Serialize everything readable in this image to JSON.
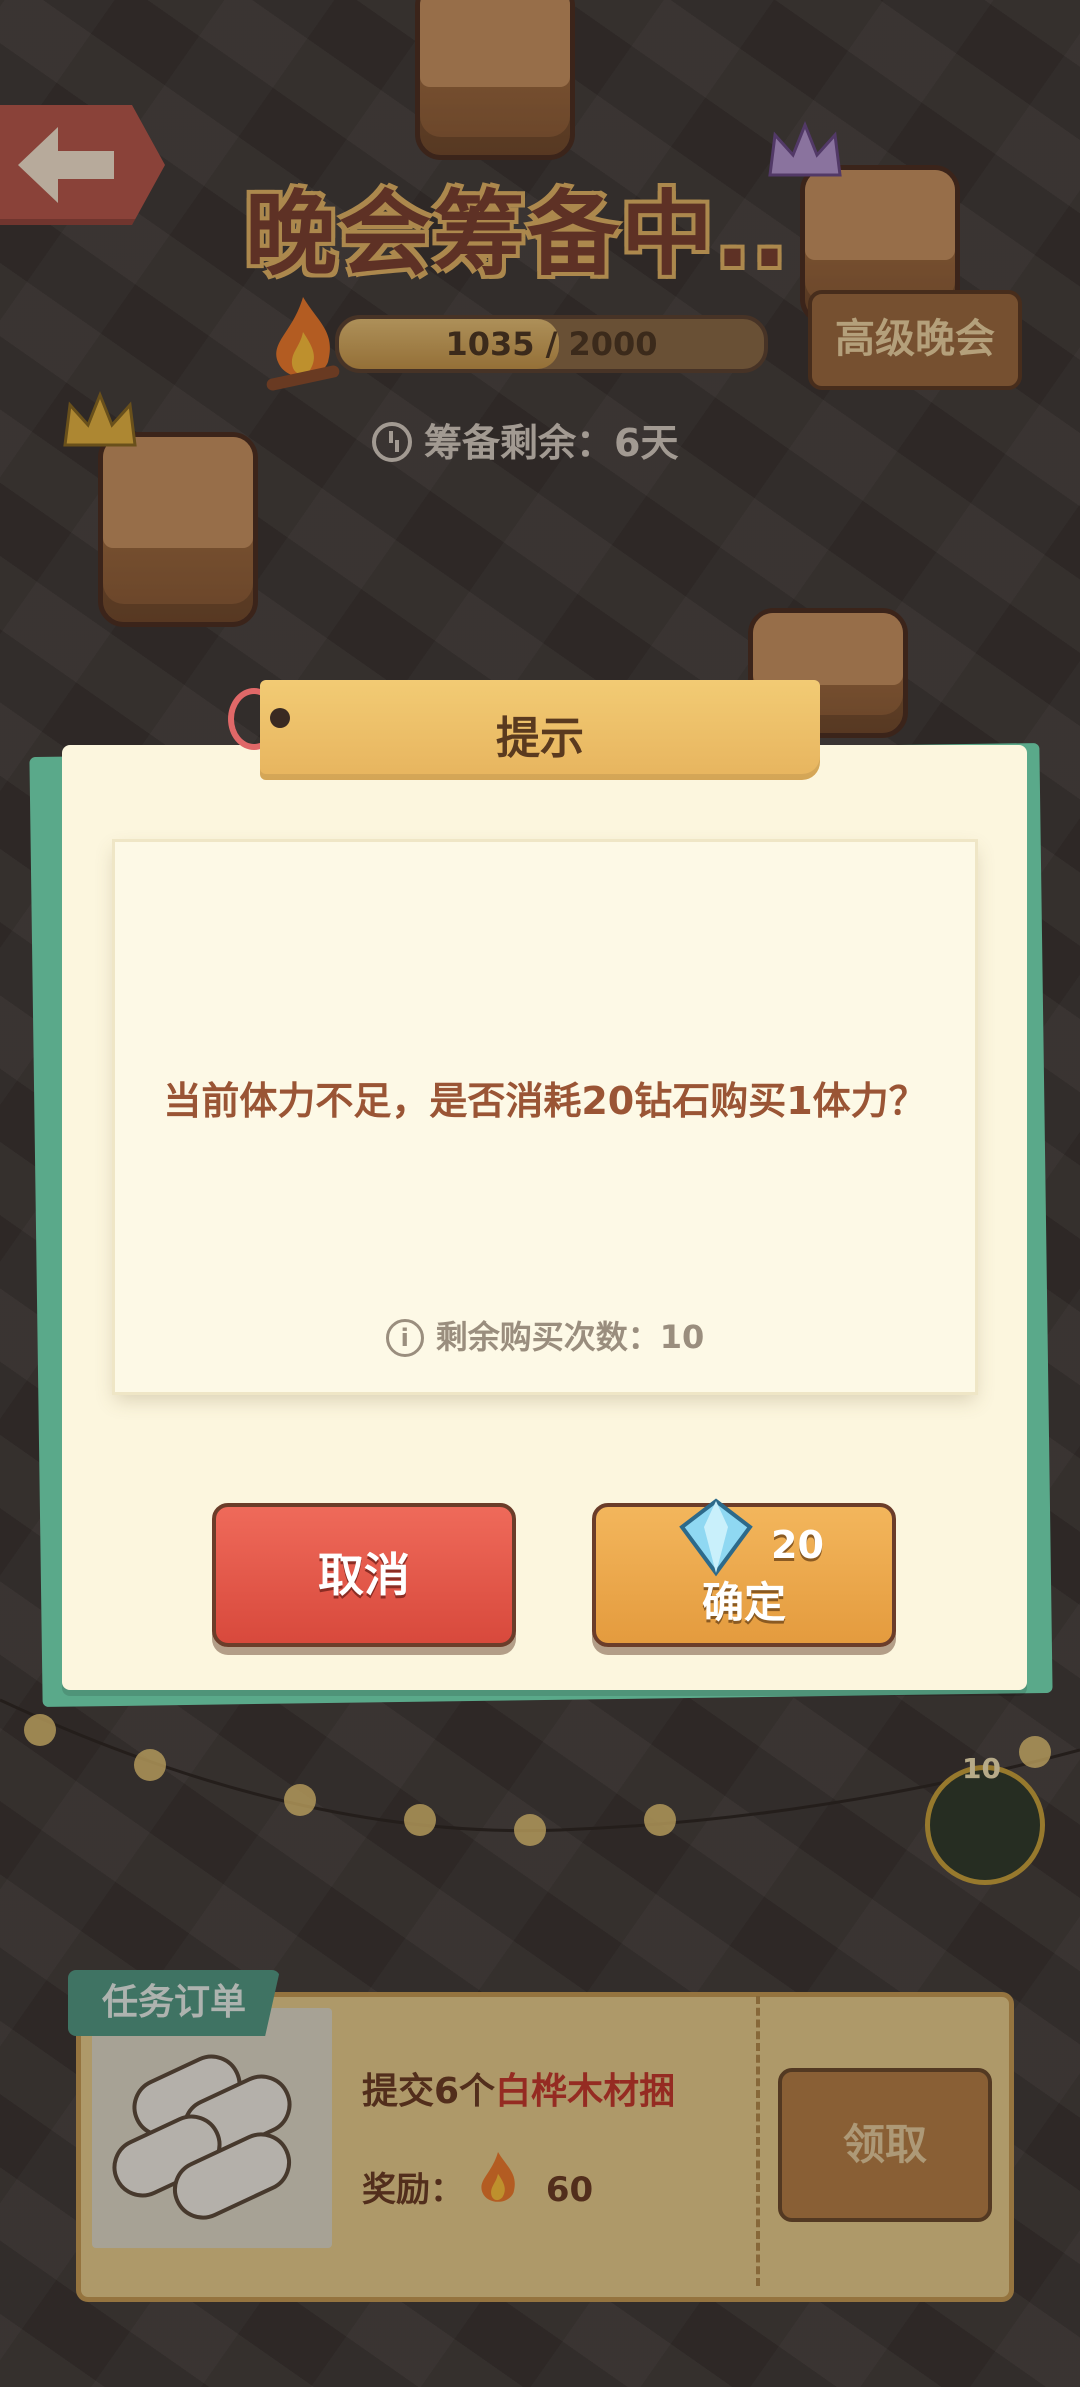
{
  "game": {
    "back_label": "",
    "title": "晚会筹备中..",
    "progress": {
      "current": 1035,
      "max": 2000,
      "text": "1035 / 2000"
    },
    "advanced_button": "高级晚会",
    "prep_remaining": "筹备剩余：6天"
  },
  "dialog": {
    "title": "提示",
    "message": "当前体力不足，是否消耗20钻石购买1体力？",
    "remaining_purchases": "剩余购买次数：10",
    "cancel_label": "取消",
    "confirm_label": "确定",
    "confirm_cost": "20"
  },
  "task": {
    "tag": "任务订单",
    "desc_prefix": "提交6个",
    "desc_item": "白桦木材捆",
    "reward_label": "奖励：",
    "reward_value": "60",
    "claim_label": "领取"
  },
  "side_badge": {
    "count": "10"
  },
  "colors": {
    "accent_title": "#7a3f2e",
    "dialog_bg": "#fcf6de",
    "cancel": "#e0574a",
    "confirm": "#eca84c",
    "task_tag": "#4f9a84"
  }
}
